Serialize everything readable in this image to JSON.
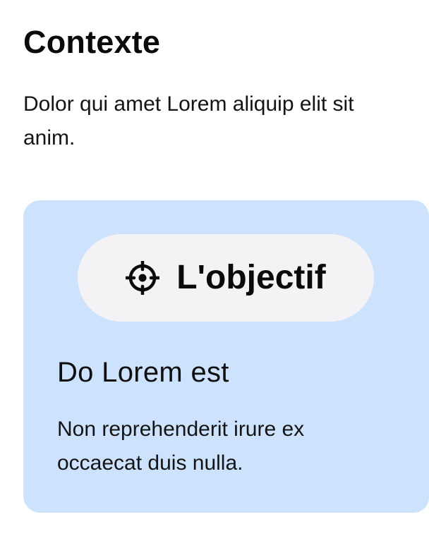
{
  "section": {
    "title": "Contexte",
    "intro": "Dolor qui amet Lorem aliquip elit sit anim."
  },
  "card": {
    "background_color": "#cde3fd",
    "pill": {
      "icon": "target-crosshair-icon",
      "label": "L'objectif",
      "background_color": "#f3f3f5"
    },
    "heading": "Do Lorem est",
    "text": "Non reprehenderit irure ex occaecat duis nulla."
  }
}
